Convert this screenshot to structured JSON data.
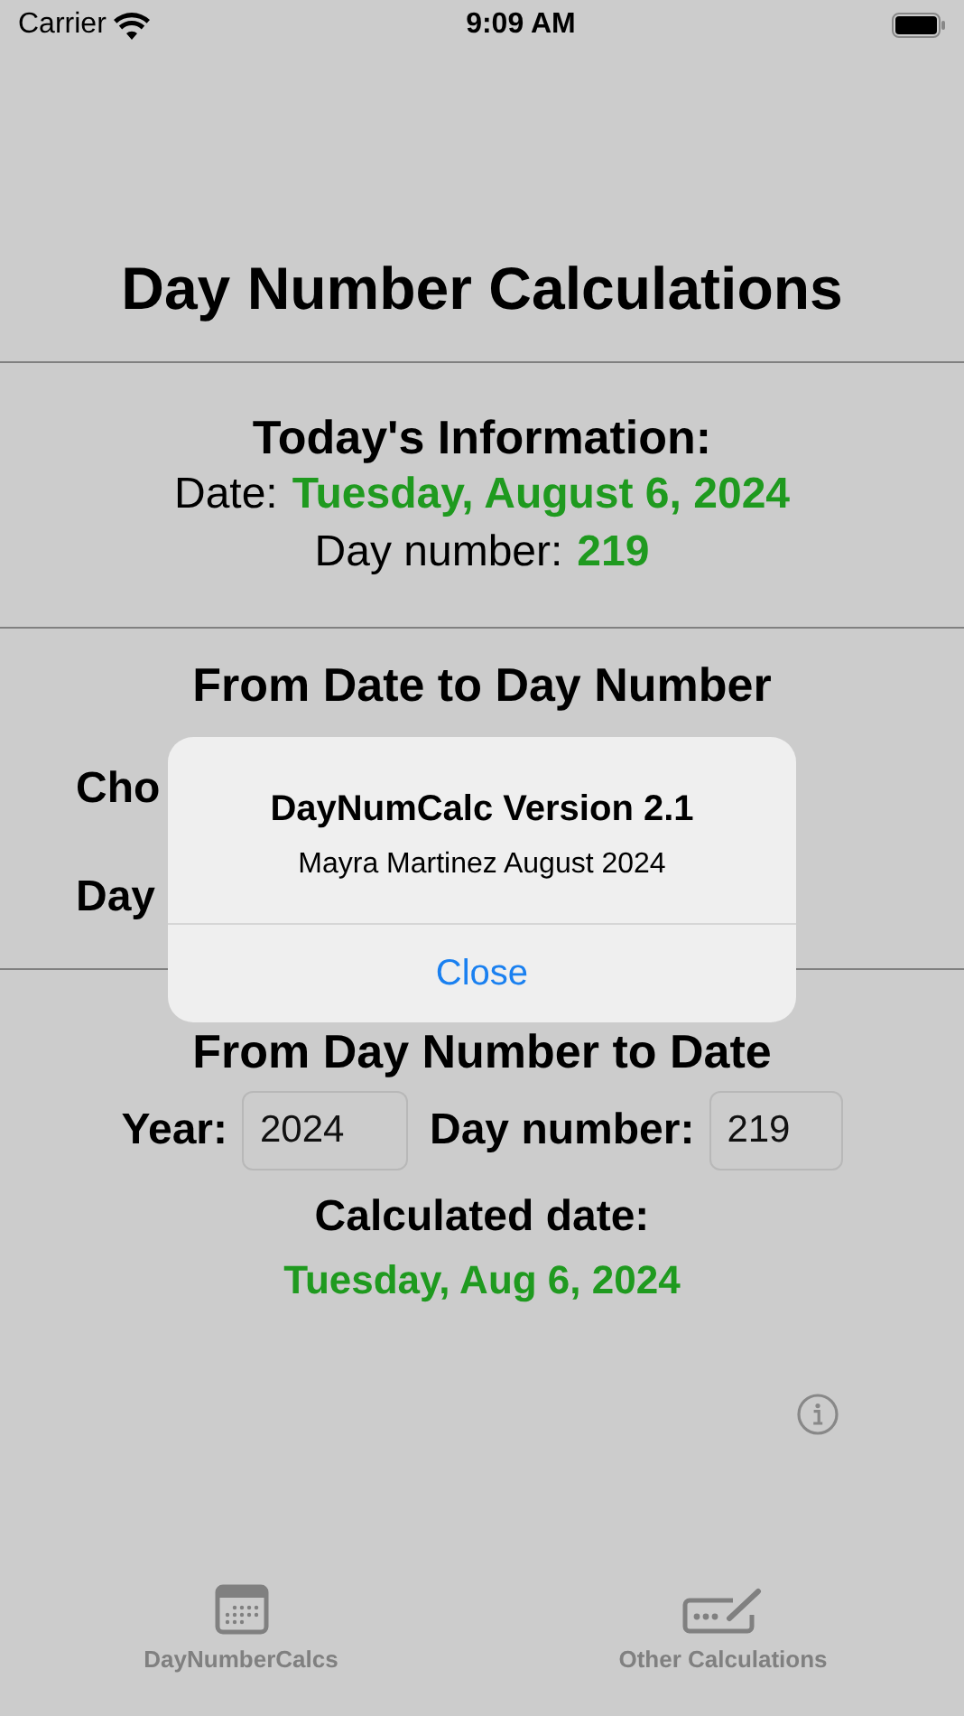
{
  "status_bar": {
    "carrier": "Carrier",
    "time": "9:09 AM"
  },
  "title": "Day Number Calculations",
  "today": {
    "heading": "Today's Information:",
    "date_label": "Date:",
    "date_value": "Tuesday, August 6, 2024",
    "day_label": "Day number:",
    "day_value": "219"
  },
  "from_date": {
    "heading": "From Date to Day Number",
    "row_1_label": "Cho",
    "row_2_label": "Day"
  },
  "from_day": {
    "heading": "From Day Number to Date",
    "year_label": "Year:",
    "year_value": "2024",
    "day_label": "Day number:",
    "day_value": "219",
    "result_label": "Calculated date:",
    "result_value": "Tuesday, Aug 6, 2024"
  },
  "alert": {
    "title": "DayNumCalc Version 2.1",
    "message": "Mayra Martinez August 2024",
    "button": "Close"
  },
  "tabs": [
    {
      "label": "DayNumberCalcs",
      "kind": "calendar"
    },
    {
      "label": "Other Calculations",
      "kind": "keyboard"
    }
  ]
}
